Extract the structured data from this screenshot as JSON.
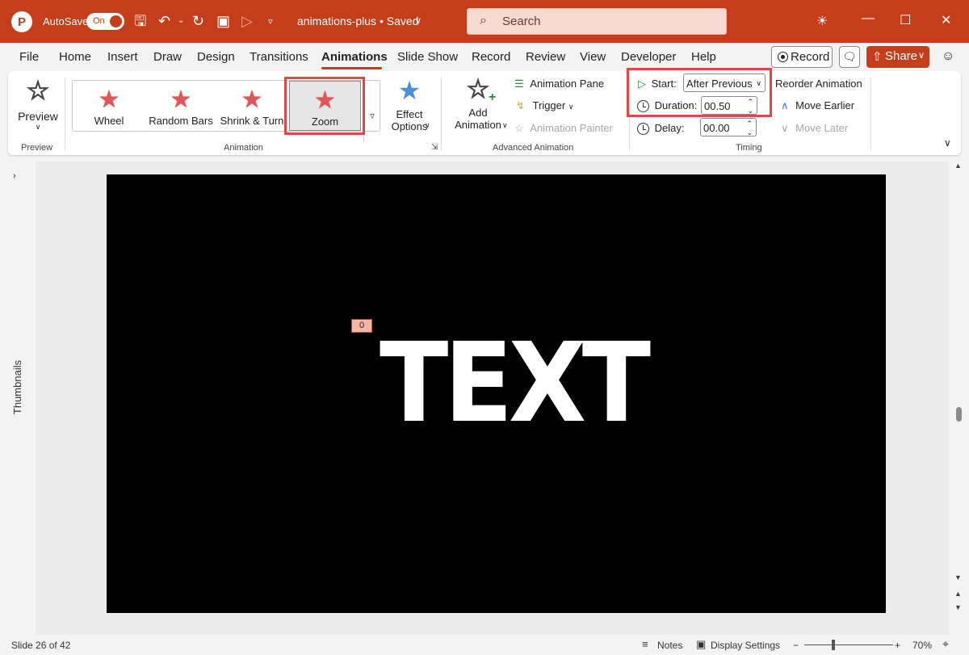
{
  "titlebar": {
    "logo": "P",
    "autosave_label": "AutoSave",
    "autosave_state": "On",
    "doc_title": "animations-plus • Saved",
    "search_placeholder": "Search",
    "icons": [
      "save-icon",
      "undo-icon",
      "redo-icon",
      "present-icon",
      "customize-icon"
    ]
  },
  "menu": {
    "tabs": [
      "File",
      "Home",
      "Insert",
      "Draw",
      "Design",
      "Transitions",
      "Animations",
      "Slide Show",
      "Record",
      "Review",
      "View",
      "Developer",
      "Help"
    ],
    "active_tab": "Animations",
    "record_label": "Record",
    "share_label": "Share"
  },
  "ribbon": {
    "preview": {
      "label": "Preview",
      "group": "Preview"
    },
    "animation_gallery": [
      {
        "label": "Wheel",
        "selected": false
      },
      {
        "label": "Random Bars",
        "selected": false
      },
      {
        "label": "Shrink & Turn",
        "selected": false
      },
      {
        "label": "Zoom",
        "selected": true
      }
    ],
    "effect_options": {
      "line1": "Effect",
      "line2": "Options"
    },
    "animation_group": "Animation",
    "add_animation": {
      "line1": "Add",
      "line2": "Animation"
    },
    "advanced": {
      "animation_pane": "Animation Pane",
      "trigger": "Trigger",
      "animation_painter": "Animation Painter",
      "group": "Advanced Animation"
    },
    "timing": {
      "start_label": "Start:",
      "start_value": "After Previous",
      "duration_label": "Duration:",
      "duration_value": "00.50",
      "delay_label": "Delay:",
      "delay_value": "00.00",
      "group": "Timing"
    },
    "reorder": {
      "title": "Reorder Animation",
      "earlier": "Move Earlier",
      "later": "Move Later"
    },
    "accent_highlight": "#e04848"
  },
  "thumbnails_label": "Thumbnails",
  "slide": {
    "text": "TEXT",
    "animation_tag": "0",
    "background": "#000000"
  },
  "status": {
    "slide_info": "Slide 26 of 42",
    "notes": "Notes",
    "display_settings": "Display Settings",
    "zoom": "70%",
    "zoom_minus": "−",
    "zoom_plus": "+"
  },
  "colors": {
    "brand": "#c43e1c"
  }
}
